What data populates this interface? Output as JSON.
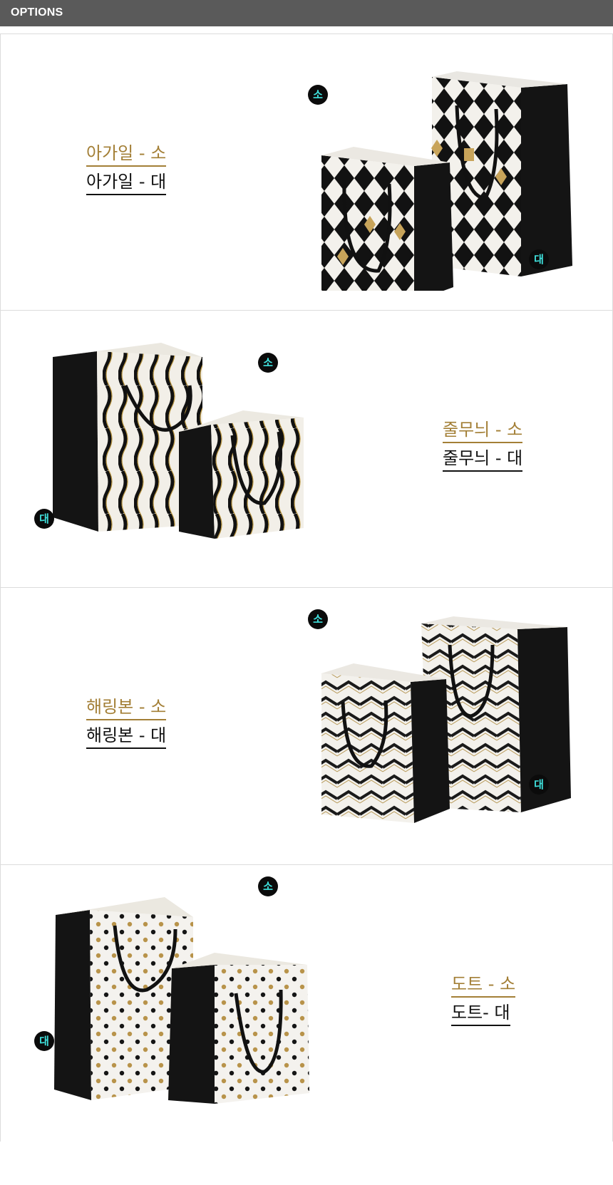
{
  "header": {
    "title": "OPTIONS"
  },
  "options": [
    {
      "small_label": "아가일 - 소",
      "large_label": "아가일 - 대"
    },
    {
      "small_label": "줄무늬 - 소",
      "large_label": "줄무늬 - 대"
    },
    {
      "small_label": "해링본 - 소",
      "large_label": "해링본 - 대"
    },
    {
      "small_label": "도트 - 소",
      "large_label": "도트- 대"
    }
  ],
  "badges": {
    "small": "소",
    "large": "대"
  },
  "colors": {
    "header_bg": "#5a5a5a",
    "small_label": "#a37f36",
    "large_label": "#111111",
    "badge_text": "#3fe0dc"
  }
}
